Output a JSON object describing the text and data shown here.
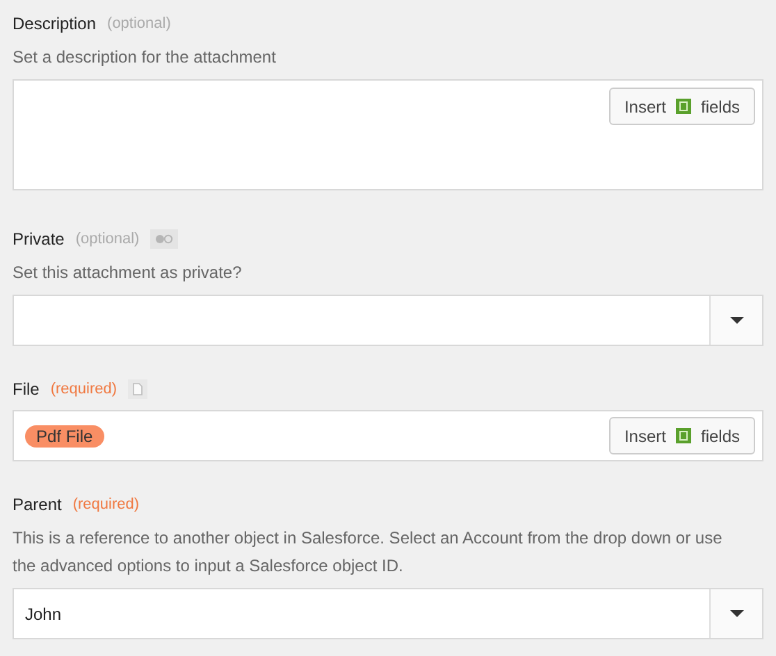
{
  "fields": [
    {
      "kind": "textarea",
      "label": "Description",
      "requirement": "(optional)",
      "required": false,
      "help": "Set a description for the attachment",
      "insert_button": "Insert",
      "insert_suffix": "fields"
    },
    {
      "kind": "select",
      "label": "Private",
      "requirement": "(optional)",
      "required": false,
      "help": "Set this attachment as private?"
    },
    {
      "kind": "token",
      "label": "File",
      "requirement": "(required)",
      "required": true,
      "token": "Pdf File",
      "insert_button": "Insert",
      "insert_suffix": "fields"
    },
    {
      "kind": "select",
      "label": "Parent",
      "requirement": "(required)",
      "required": true,
      "help": "This is a reference to another object in Salesforce. Select an Account from the drop down or use the advanced options to input a Salesforce object ID.",
      "value": "John"
    }
  ]
}
